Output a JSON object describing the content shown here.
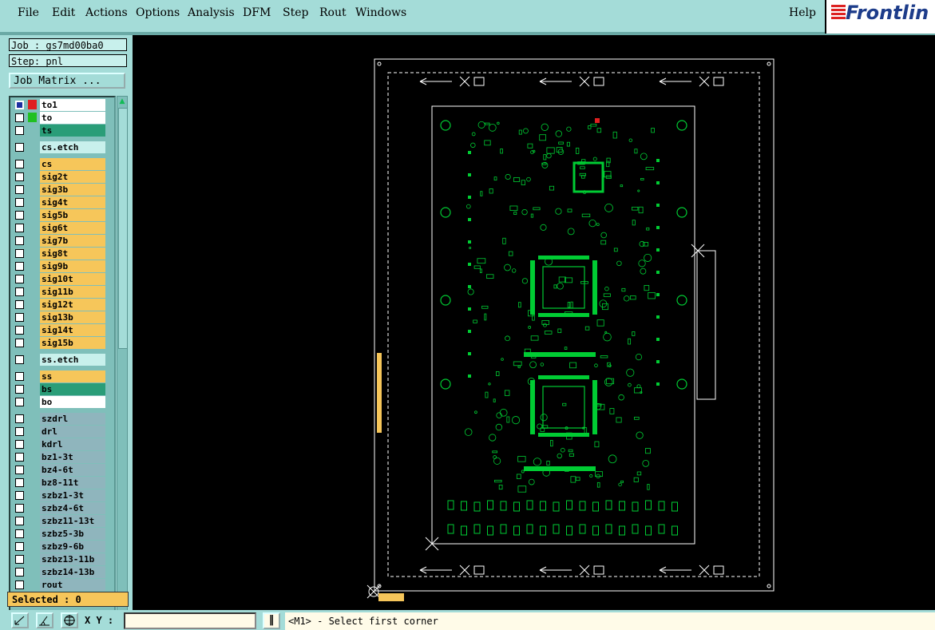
{
  "menu": {
    "file": "File",
    "edit": "Edit",
    "actions": "Actions",
    "options": "Options",
    "analysis": "Analysis",
    "dfm": "DFM",
    "step": "Step",
    "rout": "Rout",
    "windows": "Windows",
    "help": "Help"
  },
  "brand": {
    "name": "Frontlin",
    "color": "#1d3c8a",
    "accent": "#d22222"
  },
  "job": {
    "label": "Job : gs7md00ba0",
    "step": "Step: pnl",
    "matrix_button": "Job Matrix ..."
  },
  "layers": [
    {
      "name": "to1",
      "color": "#ffffff",
      "swatch": "#e02020",
      "checked": true
    },
    {
      "name": "to",
      "color": "#ffffff",
      "swatch": "#20c020",
      "checked": false
    },
    {
      "name": "ts",
      "color": "#2a9d78",
      "swatch": "",
      "checked": false
    },
    {
      "name": "cs.etch",
      "color": "#c8f0ec",
      "swatch": "",
      "checked": false
    },
    {
      "name": "cs",
      "color": "#f6c65a",
      "swatch": "",
      "checked": false
    },
    {
      "name": "sig2t",
      "color": "#f6c65a",
      "swatch": "",
      "checked": false
    },
    {
      "name": "sig3b",
      "color": "#f6c65a",
      "swatch": "",
      "checked": false
    },
    {
      "name": "sig4t",
      "color": "#f6c65a",
      "swatch": "",
      "checked": false
    },
    {
      "name": "sig5b",
      "color": "#f6c65a",
      "swatch": "",
      "checked": false
    },
    {
      "name": "sig6t",
      "color": "#f6c65a",
      "swatch": "",
      "checked": false
    },
    {
      "name": "sig7b",
      "color": "#f6c65a",
      "swatch": "",
      "checked": false
    },
    {
      "name": "sig8t",
      "color": "#f6c65a",
      "swatch": "",
      "checked": false
    },
    {
      "name": "sig9b",
      "color": "#f6c65a",
      "swatch": "",
      "checked": false
    },
    {
      "name": "sig10t",
      "color": "#f6c65a",
      "swatch": "",
      "checked": false
    },
    {
      "name": "sig11b",
      "color": "#f6c65a",
      "swatch": "",
      "checked": false
    },
    {
      "name": "sig12t",
      "color": "#f6c65a",
      "swatch": "",
      "checked": false
    },
    {
      "name": "sig13b",
      "color": "#f6c65a",
      "swatch": "",
      "checked": false
    },
    {
      "name": "sig14t",
      "color": "#f6c65a",
      "swatch": "",
      "checked": false
    },
    {
      "name": "sig15b",
      "color": "#f6c65a",
      "swatch": "",
      "checked": false
    },
    {
      "name": "ss.etch",
      "color": "#c8f0ec",
      "swatch": "",
      "checked": false
    },
    {
      "name": "ss",
      "color": "#f6c65a",
      "swatch": "",
      "checked": false
    },
    {
      "name": "bs",
      "color": "#2a9d78",
      "swatch": "",
      "checked": false
    },
    {
      "name": "bo",
      "color": "#ffffff",
      "swatch": "",
      "checked": false
    },
    {
      "name": "szdrl",
      "color": "#8fb5bd",
      "swatch": "",
      "checked": false
    },
    {
      "name": "drl",
      "color": "#8fb5bd",
      "swatch": "",
      "checked": false
    },
    {
      "name": "kdrl",
      "color": "#8fb5bd",
      "swatch": "",
      "checked": false
    },
    {
      "name": "bz1-3t",
      "color": "#8fb5bd",
      "swatch": "",
      "checked": false
    },
    {
      "name": "bz4-6t",
      "color": "#8fb5bd",
      "swatch": "",
      "checked": false
    },
    {
      "name": "bz8-11t",
      "color": "#8fb5bd",
      "swatch": "",
      "checked": false
    },
    {
      "name": "szbz1-3t",
      "color": "#8fb5bd",
      "swatch": "",
      "checked": false
    },
    {
      "name": "szbz4-6t",
      "color": "#8fb5bd",
      "swatch": "",
      "checked": false
    },
    {
      "name": "szbz11-13t",
      "color": "#8fb5bd",
      "swatch": "",
      "checked": false
    },
    {
      "name": "szbz5-3b",
      "color": "#8fb5bd",
      "swatch": "",
      "checked": false
    },
    {
      "name": "szbz9-6b",
      "color": "#8fb5bd",
      "swatch": "",
      "checked": false
    },
    {
      "name": "szbz13-11b",
      "color": "#8fb5bd",
      "swatch": "",
      "checked": false
    },
    {
      "name": "szbz14-13b",
      "color": "#8fb5bd",
      "swatch": "",
      "checked": false
    },
    {
      "name": "rout",
      "color": "#8fb5bd",
      "swatch": "",
      "checked": false
    }
  ],
  "status": {
    "selected": "Selected : 0",
    "xy_label": "X Y :",
    "xy_value": "",
    "prompt": "<M1> - Select first corner"
  },
  "colors": {
    "panel": "#a4dcd8",
    "graphics": "#00cc33",
    "outline": "#ffffff",
    "yellow": "#f6c65a",
    "red": "#e02020"
  }
}
